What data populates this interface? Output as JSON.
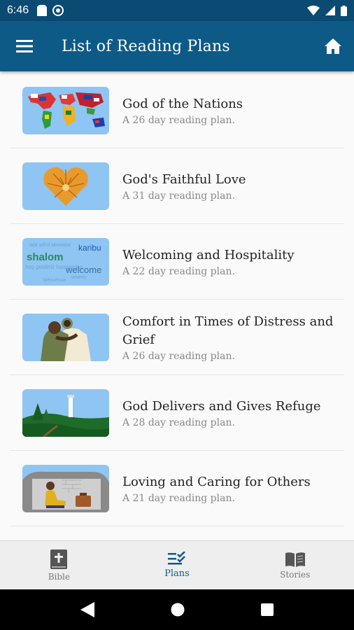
{
  "status": {
    "time": "6:46"
  },
  "app_bar": {
    "title": "List of Reading Plans"
  },
  "plans": [
    {
      "title": "God of the Nations",
      "subtitle": "A 26 day reading plan."
    },
    {
      "title": "God's Faithful Love",
      "subtitle": "A 31 day reading plan."
    },
    {
      "title": "Welcoming and Hospitality",
      "subtitle": "A 22 day reading plan."
    },
    {
      "title_line1": "Comfort in Times of Distress and",
      "title_line2": "Grief",
      "subtitle": "A 26 day reading plan."
    },
    {
      "title": "God Delivers and Gives Refuge",
      "subtitle": "A 28 day reading plan."
    },
    {
      "title": "Loving and Caring for Others",
      "subtitle": "A 21 day reading plan."
    }
  ],
  "thumb_words": {
    "w1": "karibu",
    "w2": "shalom",
    "w3": "welcome"
  },
  "bottom_nav": {
    "bible": "Bible",
    "plans": "Plans",
    "stories": "Stories"
  },
  "colors": {
    "app_bar": "#0e5a87",
    "status_bar": "#0b4a73",
    "active_tab": "#0e5a87",
    "thumb_bg": "#8ec5f2"
  },
  "icons": [
    "menu-icon",
    "home-icon",
    "bible-icon",
    "plans-icon",
    "stories-icon",
    "back-icon",
    "home-circle-icon",
    "recents-icon"
  ]
}
